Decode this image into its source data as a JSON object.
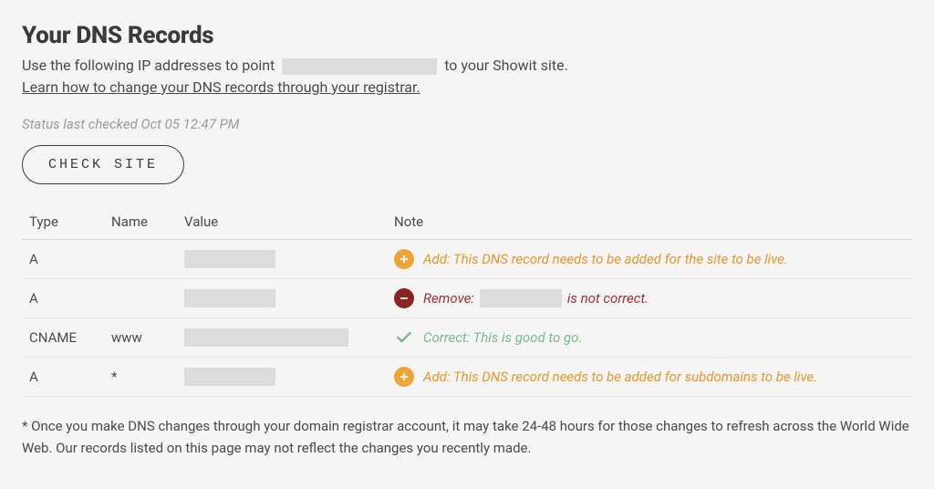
{
  "header": {
    "title": "Your DNS Records",
    "subtitle_before": "Use the following IP addresses to point",
    "subtitle_after": "to your Showit site.",
    "learn_link": "Learn how to change your DNS records through your registrar."
  },
  "status": "Status last checked Oct 05 12:47 PM",
  "check_button": "CHECK SITE",
  "table": {
    "headers": {
      "type": "Type",
      "name": "Name",
      "value": "Value",
      "note": "Note"
    },
    "rows": [
      {
        "type": "A",
        "name": "",
        "note_kind": "add",
        "note_text": "Add: This DNS record needs to be added for the site to be live."
      },
      {
        "type": "A",
        "name": "",
        "note_kind": "remove",
        "note_before": "Remove:",
        "note_after": "is not correct."
      },
      {
        "type": "CNAME",
        "name": "www",
        "note_kind": "correct",
        "note_text": "Correct: This is good to go."
      },
      {
        "type": "A",
        "name": "*",
        "note_kind": "add",
        "note_text": "Add: This DNS record needs to be added for subdomains to be live."
      }
    ]
  },
  "footnote": "* Once you make DNS changes through your domain registrar account, it may take 24-48 hours for those changes to refresh across the World Wide Web. Our records listed on this page may not reflect the changes you recently made."
}
